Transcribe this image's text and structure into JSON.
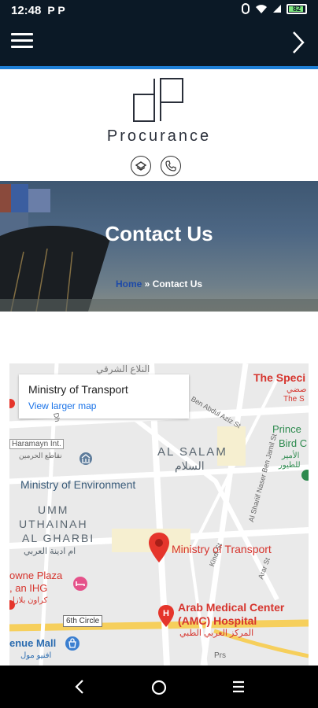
{
  "status_bar": {
    "time": "12:48",
    "notif_icons": "P P",
    "battery": "82"
  },
  "brand": {
    "name": "Procurance",
    "monogram": "dP"
  },
  "hero": {
    "title": "Contact Us",
    "breadcrumb_home": "Home",
    "breadcrumb_sep": "»",
    "breadcrumb_current": "Contact Us"
  },
  "map": {
    "card_title": "Ministry of Transport",
    "card_link": "View larger map",
    "labels": {
      "top_arabic": "النلاع الشرقي",
      "the_spec": "The Speci",
      "the_spec_ar": "صضي",
      "the_spec_s": "The S",
      "ben_abdul_aziz": "Ben Abdul Aziz St",
      "dhul": "Dh",
      "haramayn": "Haramayn Int.",
      "haramayn_ar": "نقاطع الحرمين",
      "al_salam": "AL SALAM",
      "al_salam_ar": "السلام",
      "prince": "Prince",
      "bird": "Bird C",
      "bird_ar1": "الأمير",
      "bird_ar2": "للطيور",
      "min_env": "Ministry of Environment",
      "umm1": "UMM",
      "umm2": "UTHAINAH",
      "umm3": "AL GHARBI",
      "umm_ar": "ام ادينة العربي",
      "sharif": "Al Shariif Naser Ben Jamil St",
      "min_transport_pin": "Ministry of Transport",
      "kindi": "Kindi St",
      "arar": "Arar St",
      "crowne1": "owne Plaza",
      "crowne2": ", an IHG",
      "crowne_ar": "كراون بلازا",
      "sixth_circle": "6th Circle",
      "arab_med1": "Arab Medical Center",
      "arab_med2": "(AMC) Hospital",
      "arab_med_ar": "المركز العربي الطبي",
      "enue_mall": "enue Mall",
      "enue_ar": "افنيو مول",
      "prs": "Prs"
    }
  },
  "colors": {
    "appbar": "#0b1926",
    "accent": "#1e7fd6",
    "pin": "#e5352b",
    "link": "#1a73e8"
  }
}
